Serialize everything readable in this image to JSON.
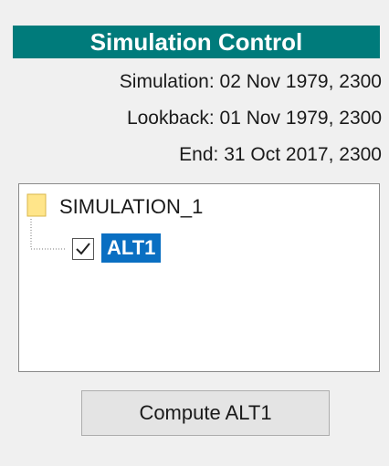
{
  "panel": {
    "title": "Simulation Control",
    "simulation_line": "Simulation: 02 Nov 1979, 2300",
    "lookback_line": "Lookback: 01 Nov 1979, 2300",
    "end_line": "End: 31 Oct 2017, 2300"
  },
  "tree": {
    "root": {
      "label": "SIMULATION_1",
      "icon": "folder-icon"
    },
    "children": [
      {
        "label": "ALT1",
        "checked": true,
        "selected": true
      }
    ]
  },
  "compute_button": {
    "label": "Compute ALT1"
  },
  "colors": {
    "title_bg": "#007b7b",
    "selection_bg": "#0a6fc2",
    "folder": "#ffe58a"
  }
}
